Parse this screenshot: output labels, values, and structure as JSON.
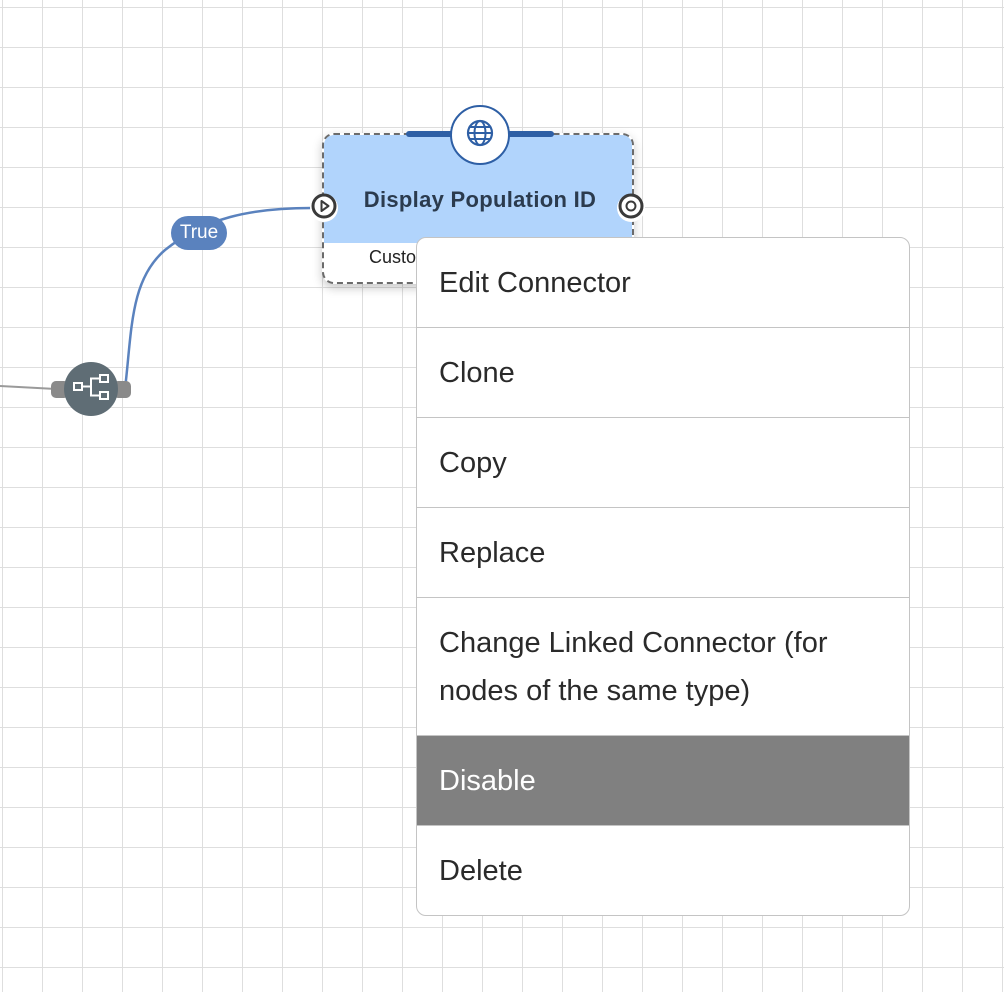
{
  "canvas": {
    "edge_label": "True"
  },
  "node": {
    "title": "Display Population ID",
    "subtitle": "Custo",
    "badge_icon": "globe-icon",
    "input_port_icon": "play-circle-icon",
    "output_port_icon": "stop-circle-icon"
  },
  "decision_node": {
    "icon": "branch-icon"
  },
  "context_menu": {
    "items": [
      {
        "label": "Edit Connector"
      },
      {
        "label": "Clone"
      },
      {
        "label": "Copy"
      },
      {
        "label": "Replace"
      },
      {
        "label": "Change Linked Connector (for nodes of the same type)"
      },
      {
        "label": "Disable",
        "highlighted": true
      },
      {
        "label": "Delete"
      }
    ]
  },
  "colors": {
    "node_header": "#b1d4fc",
    "accent_blue": "#2e5fa5",
    "edge_line": "#5a82be",
    "highlight": "#808080"
  }
}
